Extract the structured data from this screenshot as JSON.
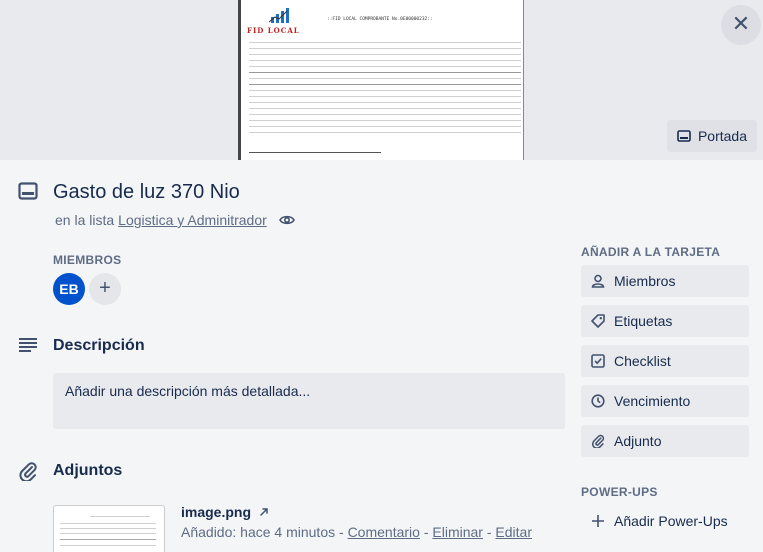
{
  "cover": {
    "doc_brand": "FID LOCAL",
    "doc_header": "::FID LOCAL COMPROBANTE No.0E00000232::",
    "button_label": "Portada"
  },
  "card": {
    "title": "Gasto de luz 370 Nio",
    "in_list_prefix": "en la lista",
    "list_name": "Logistica y Adminitrador"
  },
  "members": {
    "label": "MIEMBROS",
    "avatar_initials": "EB",
    "add_symbol": "+"
  },
  "description": {
    "title": "Descripción",
    "placeholder": "Añadir una descripción más detallada..."
  },
  "attachments": {
    "title": "Adjuntos",
    "items": [
      {
        "name": "image.png",
        "added": "Añadido: hace 4 minutos",
        "actions": [
          "Comentario",
          "Eliminar",
          "Editar"
        ]
      }
    ]
  },
  "sidebar": {
    "add_to_card_label": "AÑADIR A LA TARJETA",
    "buttons": [
      "Miembros",
      "Etiquetas",
      "Checklist",
      "Vencimiento",
      "Adjunto"
    ],
    "powerups_label": "POWER-UPS",
    "add_powerups": "Añadir Power-Ups"
  },
  "colors": {
    "avatar": "#0052cc",
    "doc_brand": "#c41e1e",
    "background": "#f4f5f7"
  }
}
